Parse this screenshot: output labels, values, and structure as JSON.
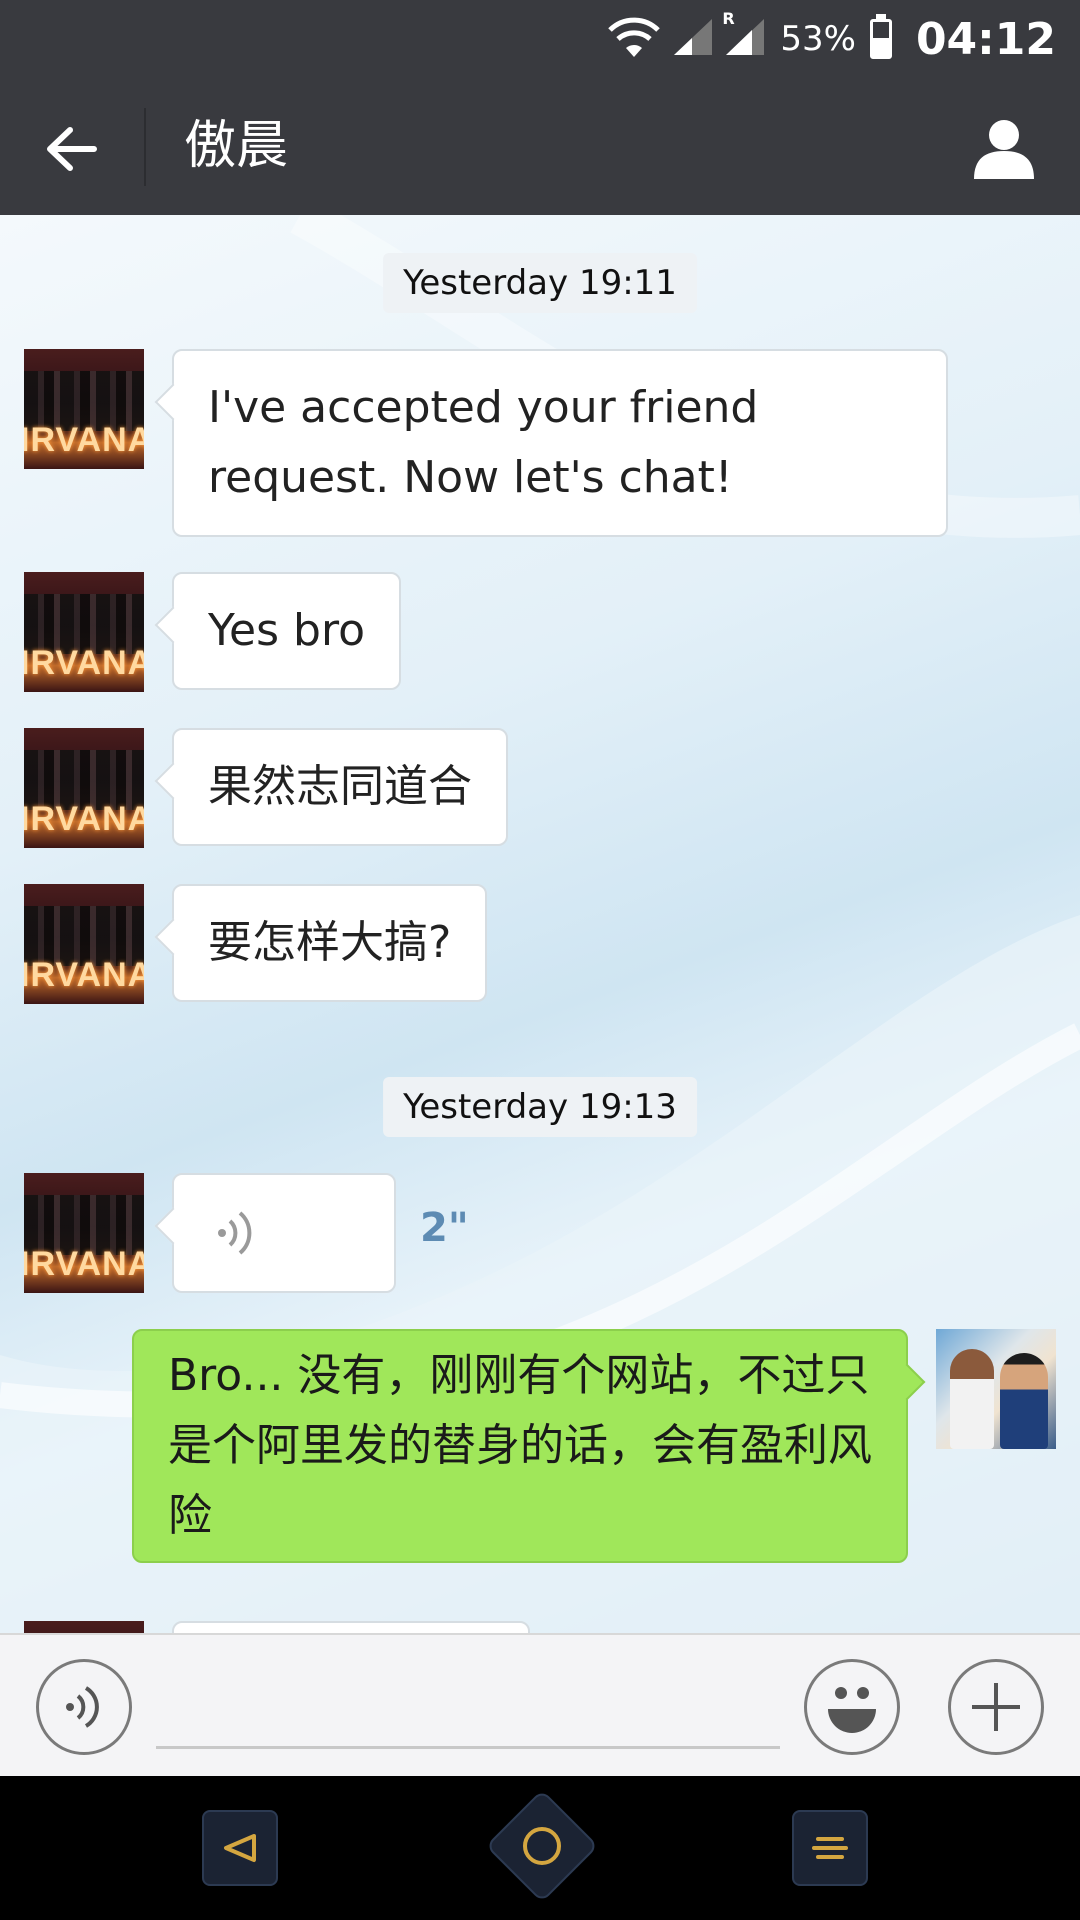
{
  "status_bar": {
    "battery_percent": "53%",
    "battery_level": 0.53,
    "time": "04:12",
    "roaming_indicator": "R",
    "icons": [
      "wifi-icon",
      "signal-icon",
      "signal-roaming-icon",
      "battery-icon"
    ]
  },
  "header": {
    "back_icon": "arrow-left-icon",
    "title": "傲晨",
    "profile_icon": "person-icon"
  },
  "chat": {
    "timestamps": [
      "Yesterday 19:11",
      "Yesterday 19:13"
    ],
    "messages": [
      {
        "sender": "friend",
        "type": "text",
        "text": "I've accepted your friend request. Now let's chat!"
      },
      {
        "sender": "friend",
        "type": "text",
        "text": "Yes bro"
      },
      {
        "sender": "friend",
        "type": "text",
        "text": "果然志同道合"
      },
      {
        "sender": "friend",
        "type": "text",
        "text": "要怎样大搞?"
      },
      {
        "sender": "friend",
        "type": "voice",
        "duration": "2\""
      },
      {
        "sender": "me",
        "type": "text",
        "text": " Bro... 没有，刚刚有个网站，不过只是个阿里发的替身的话，会有盈利风险"
      }
    ],
    "friend_avatar_sign": "IRVANA"
  },
  "input_bar": {
    "voice_icon": "voice-input-icon",
    "placeholder": "",
    "emoji_icon": "smiley-icon",
    "plus_icon": "plus-icon"
  },
  "nav_bar": {
    "icons": [
      "nav-back-icon",
      "nav-home-icon",
      "nav-menu-icon"
    ]
  },
  "colors": {
    "header_bg": "#393a3f",
    "my_bubble": "#a0e75a",
    "friend_bubble": "#ffffff",
    "voice_duration": "#5d8bb3",
    "nav_accent": "#d4a640"
  }
}
